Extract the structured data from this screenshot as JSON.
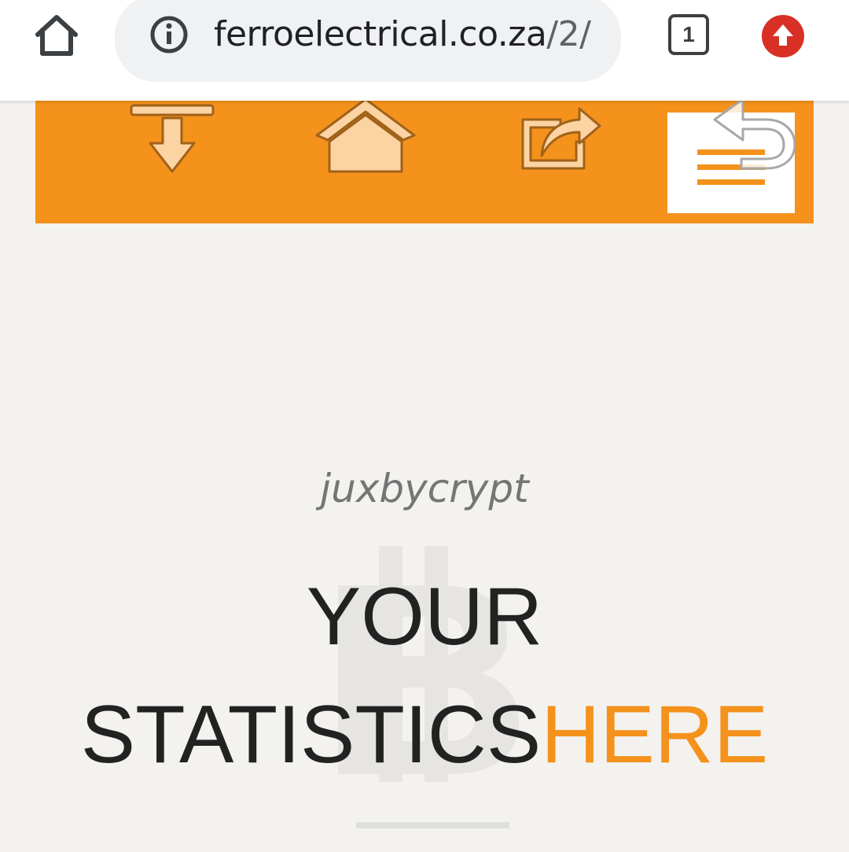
{
  "browser": {
    "url_domain": "ferroelectrical.co.za",
    "url_path": "/2/",
    "tab_count": "1",
    "icons": {
      "home": "home-icon",
      "info": "info-icon",
      "tabs": "tab-switcher-icon",
      "update": "update-arrow-icon"
    },
    "update_color": "#d93025"
  },
  "site_header": {
    "background": "#f4921c",
    "menu_icon": "hamburger-menu-icon",
    "overlay_icons": [
      "download-arrow-icon",
      "home-icon",
      "share-icon",
      "back-arrow-icon"
    ]
  },
  "hero": {
    "subtitle": "juxbycrypt",
    "headline_line1": "YOUR",
    "headline_line2_main": "STATISTICS",
    "headline_line2_highlight": "HERE",
    "watermark": "bitcoin-icon",
    "highlight_color": "#f4921c"
  }
}
